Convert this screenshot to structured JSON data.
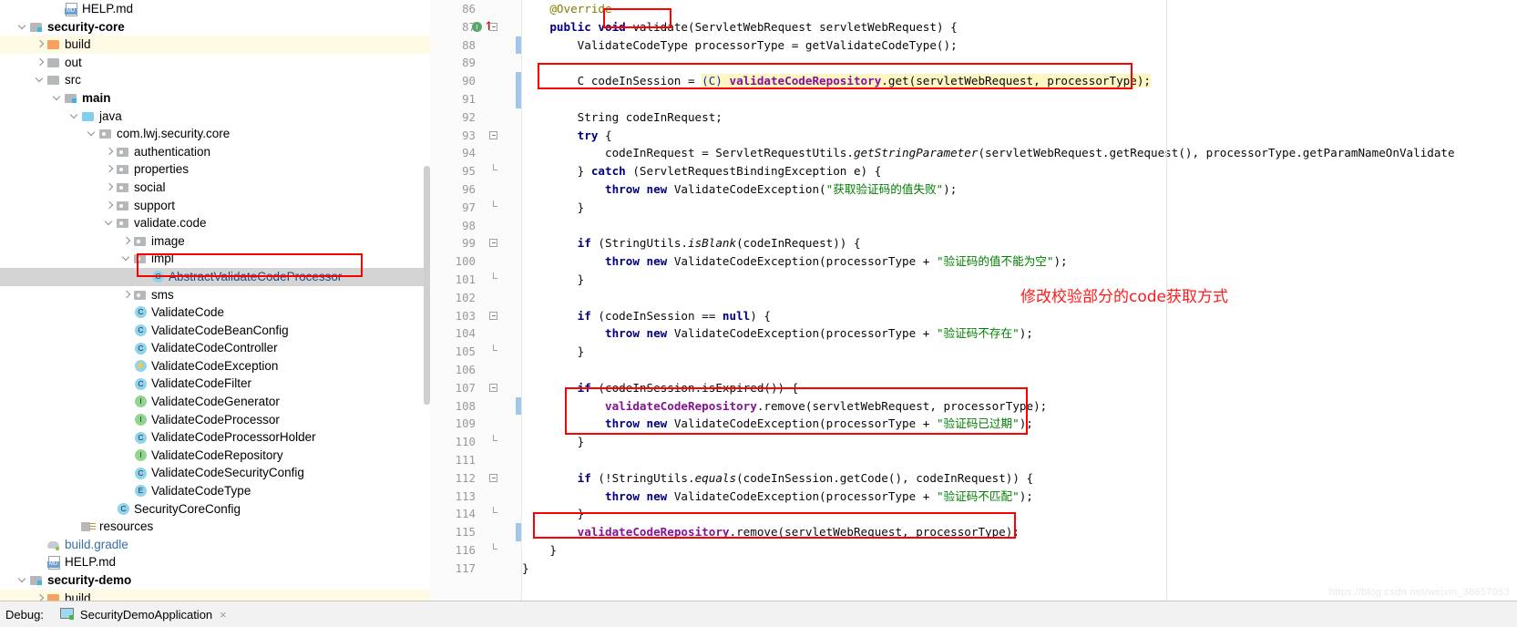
{
  "colors": {
    "annotation_red": "#ff0000",
    "selection_gray": "#d4d4d4",
    "highlight_yellow": "#fffae3",
    "cast_highlight": "#fdf6c3",
    "keyword_blue": "#000080",
    "string_green": "#008000",
    "field_purple": "#871094",
    "gutter_bg": "#fbfbfb",
    "change_stripe": "#a2c6e8"
  },
  "project_tree": {
    "items": [
      {
        "label": "HELP.md",
        "indent": 3,
        "arrow": "none",
        "icon": "md-file-icon",
        "style": "plain"
      },
      {
        "label": "security-core",
        "indent": 1,
        "arrow": "down",
        "icon": "module-folder-icon",
        "style": "bold"
      },
      {
        "label": "build",
        "indent": 2,
        "arrow": "right",
        "icon": "folder-orange-icon",
        "style": "plain",
        "row": "highlight"
      },
      {
        "label": "out",
        "indent": 2,
        "arrow": "right",
        "icon": "folder-gray-icon",
        "style": "plain"
      },
      {
        "label": "src",
        "indent": 2,
        "arrow": "down",
        "icon": "folder-gray-icon",
        "style": "plain"
      },
      {
        "label": "main",
        "indent": 3,
        "arrow": "down",
        "icon": "module-folder-icon",
        "style": "bold"
      },
      {
        "label": "java",
        "indent": 4,
        "arrow": "down",
        "icon": "folder-blue-icon",
        "style": "plain"
      },
      {
        "label": "com.lwj.security.core",
        "indent": 5,
        "arrow": "down",
        "icon": "package-icon",
        "style": "plain"
      },
      {
        "label": "authentication",
        "indent": 6,
        "arrow": "right",
        "icon": "package-icon",
        "style": "plain"
      },
      {
        "label": "properties",
        "indent": 6,
        "arrow": "right",
        "icon": "package-icon",
        "style": "plain"
      },
      {
        "label": "social",
        "indent": 6,
        "arrow": "right",
        "icon": "package-icon",
        "style": "plain"
      },
      {
        "label": "support",
        "indent": 6,
        "arrow": "right",
        "icon": "package-icon",
        "style": "plain"
      },
      {
        "label": "validate.code",
        "indent": 6,
        "arrow": "down",
        "icon": "package-icon",
        "style": "plain"
      },
      {
        "label": "image",
        "indent": 7,
        "arrow": "right",
        "icon": "package-icon",
        "style": "plain"
      },
      {
        "label": "impl",
        "indent": 7,
        "arrow": "down",
        "icon": "package-icon",
        "style": "plain"
      },
      {
        "label": "AbstractValidateCodeProcessor",
        "indent": 8,
        "arrow": "none",
        "icon": "class-icon",
        "style": "selected",
        "row": "selected"
      },
      {
        "label": "sms",
        "indent": 7,
        "arrow": "right",
        "icon": "package-icon",
        "style": "plain"
      },
      {
        "label": "ValidateCode",
        "indent": 7,
        "arrow": "none",
        "icon": "class-icon",
        "style": "plain"
      },
      {
        "label": "ValidateCodeBeanConfig",
        "indent": 7,
        "arrow": "none",
        "icon": "class-icon",
        "style": "plain"
      },
      {
        "label": "ValidateCodeController",
        "indent": 7,
        "arrow": "none",
        "icon": "class-icon",
        "style": "plain"
      },
      {
        "label": "ValidateCodeException",
        "indent": 7,
        "arrow": "none",
        "icon": "exception-icon",
        "style": "plain"
      },
      {
        "label": "ValidateCodeFilter",
        "indent": 7,
        "arrow": "none",
        "icon": "class-icon",
        "style": "plain"
      },
      {
        "label": "ValidateCodeGenerator",
        "indent": 7,
        "arrow": "none",
        "icon": "interface-icon",
        "style": "plain"
      },
      {
        "label": "ValidateCodeProcessor",
        "indent": 7,
        "arrow": "none",
        "icon": "interface-icon",
        "style": "plain"
      },
      {
        "label": "ValidateCodeProcessorHolder",
        "indent": 7,
        "arrow": "none",
        "icon": "class-icon",
        "style": "plain"
      },
      {
        "label": "ValidateCodeRepository",
        "indent": 7,
        "arrow": "none",
        "icon": "interface-icon",
        "style": "plain"
      },
      {
        "label": "ValidateCodeSecurityConfig",
        "indent": 7,
        "arrow": "none",
        "icon": "class-icon",
        "style": "plain"
      },
      {
        "label": "ValidateCodeType",
        "indent": 7,
        "arrow": "none",
        "icon": "enum-icon",
        "style": "plain"
      },
      {
        "label": "SecurityCoreConfig",
        "indent": 6,
        "arrow": "none",
        "icon": "class-icon",
        "style": "plain"
      },
      {
        "label": "resources",
        "indent": 4,
        "arrow": "none",
        "icon": "resources-folder-icon",
        "style": "plain"
      },
      {
        "label": "build.gradle",
        "indent": 2,
        "arrow": "none",
        "icon": "gradle-file-icon",
        "style": "blue"
      },
      {
        "label": "HELP.md",
        "indent": 2,
        "arrow": "none",
        "icon": "md-file-icon",
        "style": "plain"
      },
      {
        "label": "security-demo",
        "indent": 1,
        "arrow": "down",
        "icon": "module-folder-icon",
        "style": "bold"
      },
      {
        "label": "build",
        "indent": 2,
        "arrow": "right",
        "icon": "folder-orange-icon",
        "style": "plain",
        "row": "highlight"
      }
    ]
  },
  "editor": {
    "first_line_number": 86,
    "lines": [
      {
        "n": 86,
        "tokens": [
          {
            "t": "    ",
            "c": "plain"
          },
          {
            "t": "@Override",
            "c": "ann"
          }
        ]
      },
      {
        "n": 87,
        "tokens": [
          {
            "t": "    ",
            "c": "plain"
          },
          {
            "t": "public void ",
            "c": "kw"
          },
          {
            "t": "validate",
            "c": "plain"
          },
          {
            "t": "(ServletWebRequest servletWebRequest) {",
            "c": "plain"
          }
        ],
        "gutter_icon": "override-method-icon",
        "fold": "minus"
      },
      {
        "n": 88,
        "tokens": [
          {
            "t": "        ValidateCodeType processorType = getValidateCodeType();",
            "c": "plain"
          }
        ],
        "changed": true
      },
      {
        "n": 89,
        "tokens": [
          {
            "t": "",
            "c": "plain"
          }
        ]
      },
      {
        "n": 90,
        "tokens": [
          {
            "t": "        C codeInSession = ",
            "c": "plain"
          },
          {
            "t": "(C) ",
            "c": "cast-hl"
          },
          {
            "t": "validateCodeRepository",
            "c": "fld-hl"
          },
          {
            "t": ".get(servletWebRequest, processorType);",
            "c": "plain-hl"
          }
        ],
        "changed": true
      },
      {
        "n": 91,
        "tokens": [
          {
            "t": "",
            "c": "plain"
          }
        ],
        "changed": true
      },
      {
        "n": 92,
        "tokens": [
          {
            "t": "        String codeInRequest;",
            "c": "plain"
          }
        ]
      },
      {
        "n": 93,
        "tokens": [
          {
            "t": "        try",
            "c": "kw-part"
          },
          {
            "t": " {",
            "c": "plain"
          }
        ],
        "fold": "minus"
      },
      {
        "n": 94,
        "tokens": [
          {
            "t": "            codeInRequest = ServletRequestUtils.",
            "c": "plain"
          },
          {
            "t": "getStringParameter",
            "c": "stat"
          },
          {
            "t": "(servletWebRequest.getRequest(), processorType.getParamNameOnValidate",
            "c": "plain"
          }
        ]
      },
      {
        "n": 95,
        "tokens": [
          {
            "t": "        } ",
            "c": "plain"
          },
          {
            "t": "catch",
            "c": "kw"
          },
          {
            "t": " (ServletRequestBindingException e) {",
            "c": "plain"
          }
        ],
        "fold": "end"
      },
      {
        "n": 96,
        "tokens": [
          {
            "t": "            ",
            "c": "plain"
          },
          {
            "t": "throw new ",
            "c": "kw"
          },
          {
            "t": "ValidateCodeException(",
            "c": "plain"
          },
          {
            "t": "\"获取验证码的值失败\"",
            "c": "str"
          },
          {
            "t": ");",
            "c": "plain"
          }
        ]
      },
      {
        "n": 97,
        "tokens": [
          {
            "t": "        }",
            "c": "plain"
          }
        ],
        "fold": "end"
      },
      {
        "n": 98,
        "tokens": [
          {
            "t": "",
            "c": "plain"
          }
        ]
      },
      {
        "n": 99,
        "tokens": [
          {
            "t": "        ",
            "c": "plain"
          },
          {
            "t": "if",
            "c": "kw"
          },
          {
            "t": " (StringUtils.",
            "c": "plain"
          },
          {
            "t": "isBlank",
            "c": "stat"
          },
          {
            "t": "(codeInRequest)) {",
            "c": "plain"
          }
        ],
        "fold": "minus"
      },
      {
        "n": 100,
        "tokens": [
          {
            "t": "            ",
            "c": "plain"
          },
          {
            "t": "throw new ",
            "c": "kw"
          },
          {
            "t": "ValidateCodeException(processorType + ",
            "c": "plain"
          },
          {
            "t": "\"验证码的值不能为空\"",
            "c": "str"
          },
          {
            "t": ");",
            "c": "plain"
          }
        ]
      },
      {
        "n": 101,
        "tokens": [
          {
            "t": "        }",
            "c": "plain"
          }
        ],
        "fold": "end"
      },
      {
        "n": 102,
        "tokens": [
          {
            "t": "",
            "c": "plain"
          }
        ]
      },
      {
        "n": 103,
        "tokens": [
          {
            "t": "        ",
            "c": "plain"
          },
          {
            "t": "if",
            "c": "kw"
          },
          {
            "t": " (codeInSession == ",
            "c": "plain"
          },
          {
            "t": "null",
            "c": "kw"
          },
          {
            "t": ") {",
            "c": "plain"
          }
        ],
        "fold": "minus"
      },
      {
        "n": 104,
        "tokens": [
          {
            "t": "            ",
            "c": "plain"
          },
          {
            "t": "throw new ",
            "c": "kw"
          },
          {
            "t": "ValidateCodeException(processorType + ",
            "c": "plain"
          },
          {
            "t": "\"验证码不存在\"",
            "c": "str"
          },
          {
            "t": ");",
            "c": "plain"
          }
        ]
      },
      {
        "n": 105,
        "tokens": [
          {
            "t": "        }",
            "c": "plain"
          }
        ],
        "fold": "end"
      },
      {
        "n": 106,
        "tokens": [
          {
            "t": "",
            "c": "plain"
          }
        ]
      },
      {
        "n": 107,
        "tokens": [
          {
            "t": "        ",
            "c": "plain"
          },
          {
            "t": "if",
            "c": "kw"
          },
          {
            "t": " (codeInSession.isExpired()) {",
            "c": "plain"
          }
        ],
        "fold": "minus"
      },
      {
        "n": 108,
        "tokens": [
          {
            "t": "            ",
            "c": "plain"
          },
          {
            "t": "validateCodeRepository",
            "c": "fld"
          },
          {
            "t": ".remove(servletWebRequest, processorType);",
            "c": "plain"
          }
        ],
        "changed": true
      },
      {
        "n": 109,
        "tokens": [
          {
            "t": "            ",
            "c": "plain"
          },
          {
            "t": "throw new ",
            "c": "kw"
          },
          {
            "t": "ValidateCodeException(processorType + ",
            "c": "plain"
          },
          {
            "t": "\"验证码已过期\"",
            "c": "str"
          },
          {
            "t": ");",
            "c": "plain"
          }
        ]
      },
      {
        "n": 110,
        "tokens": [
          {
            "t": "        }",
            "c": "plain"
          }
        ],
        "fold": "end"
      },
      {
        "n": 111,
        "tokens": [
          {
            "t": "",
            "c": "plain"
          }
        ]
      },
      {
        "n": 112,
        "tokens": [
          {
            "t": "        ",
            "c": "plain"
          },
          {
            "t": "if",
            "c": "kw"
          },
          {
            "t": " (!StringUtils.",
            "c": "plain"
          },
          {
            "t": "equals",
            "c": "stat"
          },
          {
            "t": "(codeInSession.getCode(), codeInRequest)) {",
            "c": "plain"
          }
        ],
        "fold": "minus"
      },
      {
        "n": 113,
        "tokens": [
          {
            "t": "            ",
            "c": "plain"
          },
          {
            "t": "throw new ",
            "c": "kw"
          },
          {
            "t": "ValidateCodeException(processorType + ",
            "c": "plain"
          },
          {
            "t": "\"验证码不匹配\"",
            "c": "str"
          },
          {
            "t": ");",
            "c": "plain"
          }
        ]
      },
      {
        "n": 114,
        "tokens": [
          {
            "t": "        }",
            "c": "plain"
          }
        ],
        "fold": "end"
      },
      {
        "n": 115,
        "tokens": [
          {
            "t": "        ",
            "c": "plain"
          },
          {
            "t": "validateCodeRepository",
            "c": "fld"
          },
          {
            "t": ".remove(servletWebRequest, processorType);",
            "c": "plain"
          }
        ],
        "changed": true
      },
      {
        "n": 116,
        "tokens": [
          {
            "t": "    }",
            "c": "plain"
          }
        ],
        "fold": "end"
      },
      {
        "n": 117,
        "tokens": [
          {
            "t": "}",
            "c": "plain"
          }
        ]
      }
    ],
    "annotation_note": "修改校验部分的code获取方式"
  },
  "debug_bar": {
    "label": "Debug:",
    "session_name": "SecurityDemoApplication",
    "close_glyph": "×"
  },
  "watermark": "https://blog.csdn.net/weixin_38657053"
}
